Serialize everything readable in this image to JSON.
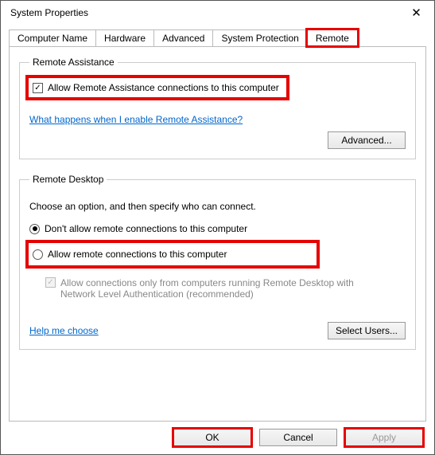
{
  "window": {
    "title": "System Properties",
    "close_glyph": "✕"
  },
  "tabs": {
    "computer_name": "Computer Name",
    "hardware": "Hardware",
    "advanced": "Advanced",
    "system_protection": "System Protection",
    "remote": "Remote"
  },
  "remote_assistance": {
    "legend": "Remote Assistance",
    "allow_label": "Allow Remote Assistance connections to this computer",
    "allow_checked_glyph": "✓",
    "help_link": "What happens when I enable Remote Assistance?",
    "advanced_btn": "Advanced..."
  },
  "remote_desktop": {
    "legend": "Remote Desktop",
    "prompt": "Choose an option, and then specify who can connect.",
    "opt_dont_allow": "Don't allow remote connections to this computer",
    "opt_allow": "Allow remote connections to this computer",
    "nla_label": "Allow connections only from computers running Remote Desktop with Network Level Authentication (recommended)",
    "nla_checked_glyph": "✓",
    "help_link": "Help me choose",
    "select_users_btn": "Select Users..."
  },
  "footer": {
    "ok": "OK",
    "cancel": "Cancel",
    "apply": "Apply"
  }
}
